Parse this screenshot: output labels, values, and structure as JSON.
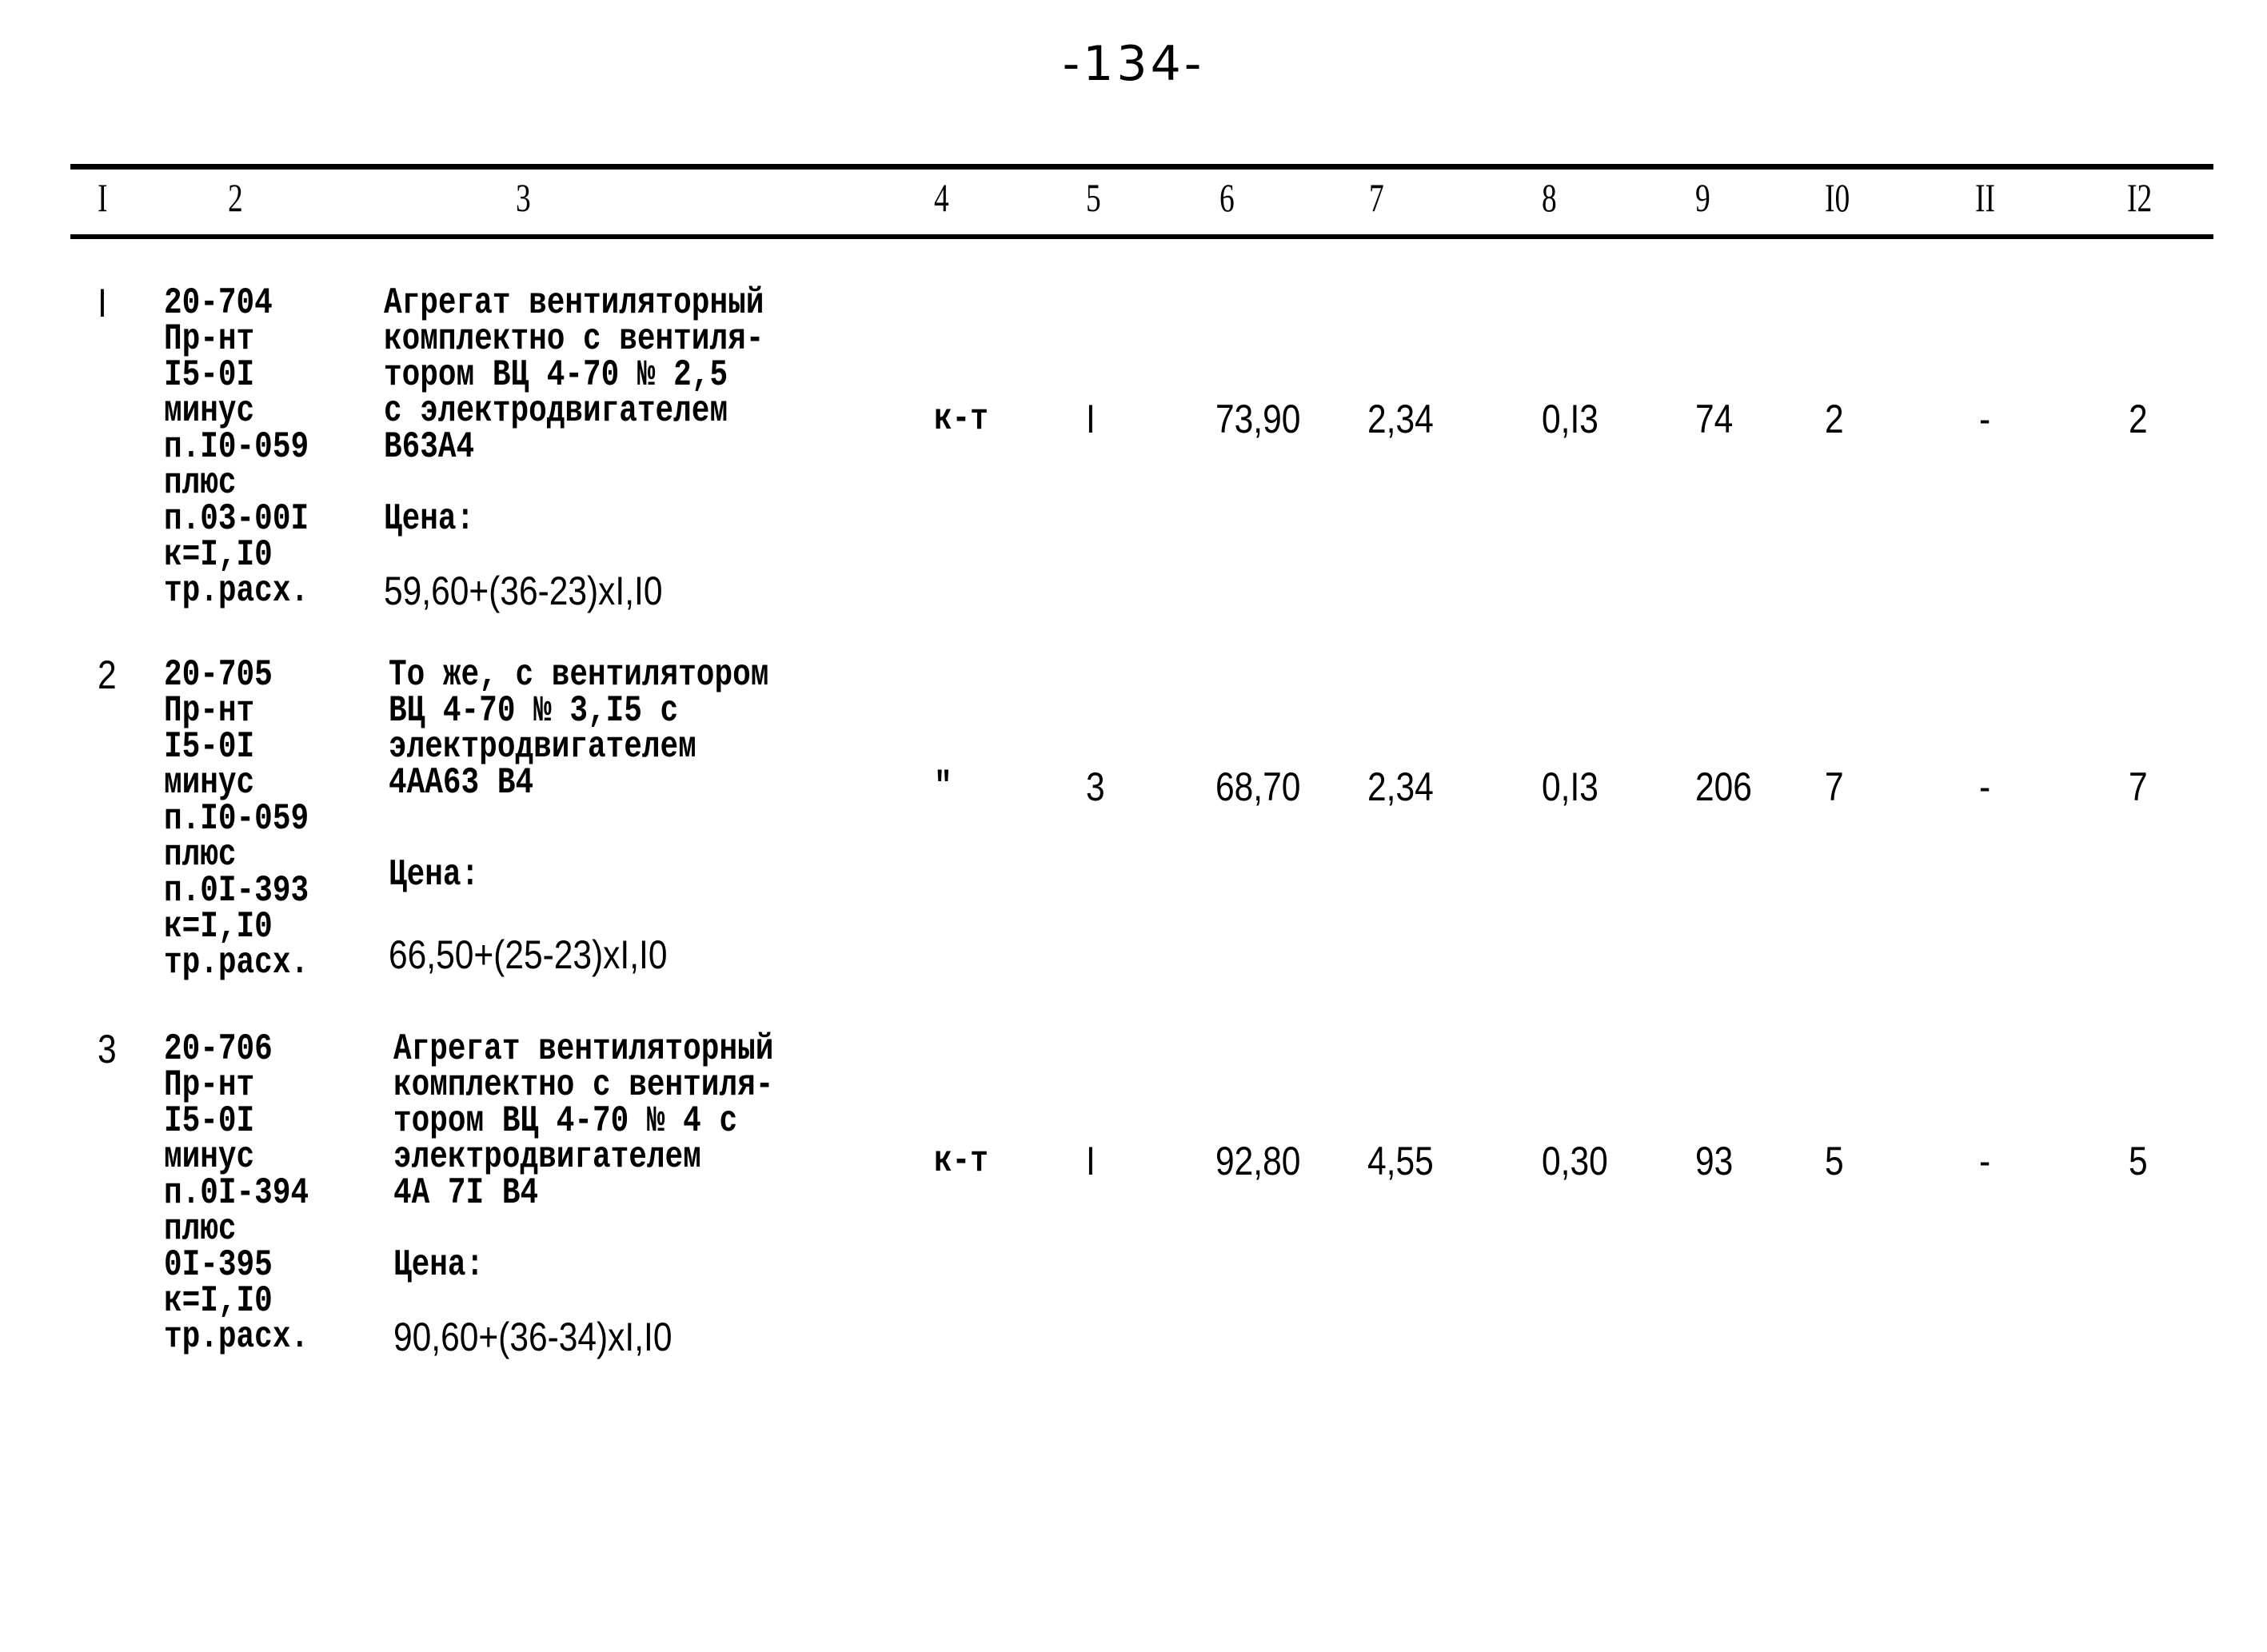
{
  "page_number": "-134-",
  "table": {
    "headers": [
      "I",
      "2",
      "3",
      "4",
      "5",
      "6",
      "7",
      "8",
      "9",
      "I0",
      "II",
      "I2"
    ],
    "rows": [
      {
        "no": "I",
        "code_lines": [
          "20-704",
          "Пр-нт",
          "I5-0I",
          "минус",
          "п.I0-059",
          "плюс",
          "п.03-00I",
          "к=I,I0",
          "тр.расх."
        ],
        "desc_lines": [
          "Агрегат вентиляторный",
          "комплектно с вентиля-",
          "тором ВЦ 4-70 № 2,5",
          "с электродвигателем",
          "В63А4"
        ],
        "price_label": "Цена:",
        "price_formula": "59,60+(36-23)xI,I0",
        "unit": "к-т",
        "qty": "I",
        "c6": "73,90",
        "c7": "2,34",
        "c8": "0,I3",
        "c9": "74",
        "c10": "2",
        "c11": "-",
        "c12": "2"
      },
      {
        "no": "2",
        "code_lines": [
          "20-705",
          "Пр-нт",
          "I5-0I",
          "минус",
          "п.I0-059",
          "плюс",
          "п.0I-393",
          "к=I,I0",
          "тр.расх."
        ],
        "desc_lines": [
          "То же, с вентилятором",
          "ВЦ 4-70 № 3,I5 с",
          "электродвигателем",
          "4АА63 В4"
        ],
        "price_label": "Цена:",
        "price_formula": "66,50+(25-23)xI,I0",
        "unit": "\"",
        "qty": "3",
        "c6": "68,70",
        "c7": "2,34",
        "c8": "0,I3",
        "c9": "206",
        "c10": "7",
        "c11": "-",
        "c12": "7"
      },
      {
        "no": "3",
        "code_lines": [
          "20-706",
          "Пр-нт",
          "I5-0I",
          "минус",
          "п.0I-394",
          "плюс",
          "0I-395",
          "к=I,I0",
          "тр.расх."
        ],
        "desc_lines": [
          "Агрегат вентиляторный",
          "комплектно с вентиля-",
          "тором ВЦ 4-70 № 4 с",
          "электродвигателем",
          "4А 7I В4"
        ],
        "price_label": "Цена:",
        "price_formula": "90,60+(36-34)xI,I0",
        "unit": "к-т",
        "qty": "I",
        "c6": "92,80",
        "c7": "4,55",
        "c8": "0,30",
        "c9": "93",
        "c10": "5",
        "c11": "-",
        "c12": "5"
      }
    ]
  }
}
